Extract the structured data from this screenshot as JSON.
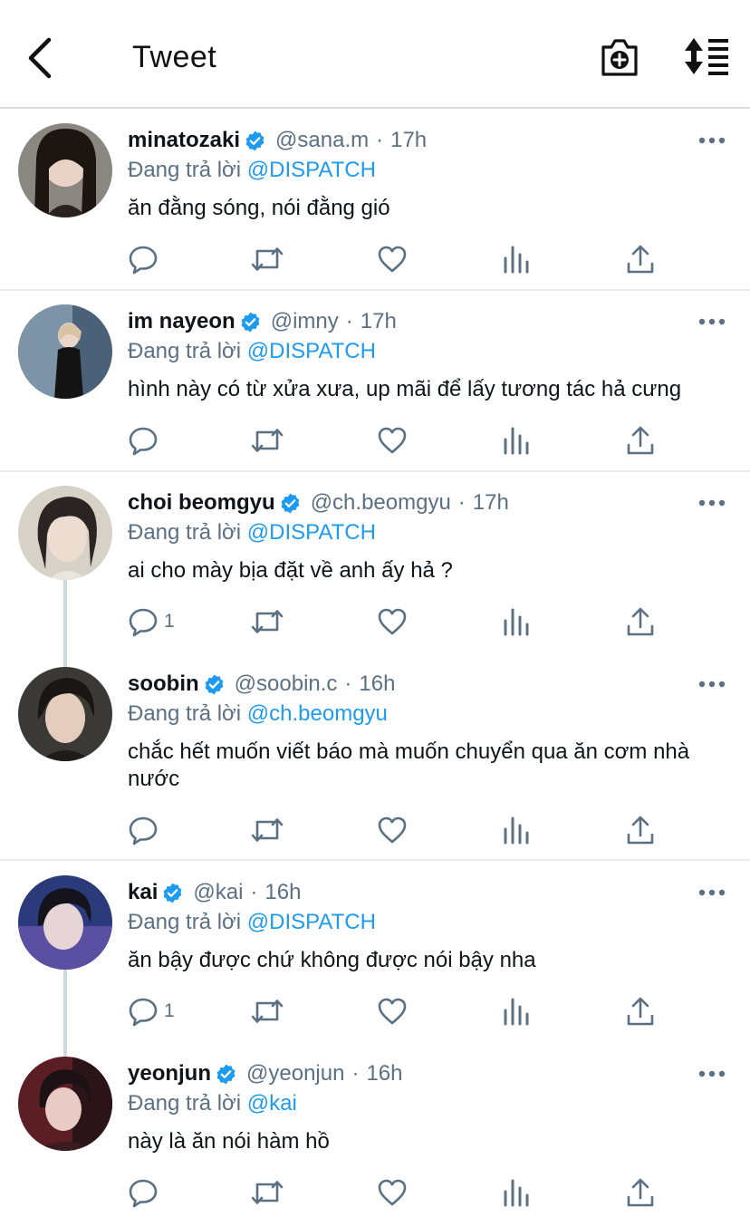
{
  "header": {
    "title": "Tweet"
  },
  "reply_prefix": "Đang trả lời",
  "tweets": [
    {
      "name": "minatozaki",
      "handle": "@sana.m",
      "time": "17h",
      "reply_to": "@DISPATCH",
      "text": "ăn đằng sóng, nói đằng gió",
      "reply_count": ""
    },
    {
      "name": "im nayeon",
      "handle": "@imny",
      "time": "17h",
      "reply_to": "@DISPATCH",
      "text": "hình này có từ xửa xưa, up mãi để lấy tương tác hả cưng",
      "reply_count": ""
    },
    {
      "name": "choi beomgyu",
      "handle": "@ch.beomgyu",
      "time": "17h",
      "reply_to": "@DISPATCH",
      "text": "ai cho mày bịa đặt về anh ấy hả ?",
      "reply_count": "1"
    },
    {
      "name": "soobin",
      "handle": "@soobin.c",
      "time": "16h",
      "reply_to": "@ch.beomgyu",
      "text": "chắc hết muốn viết báo mà muốn chuyển qua ăn cơm nhà nước",
      "reply_count": ""
    },
    {
      "name": "kai",
      "handle": "@kai",
      "time": "16h",
      "reply_to": "@DISPATCH",
      "text": "ăn bậy được chứ không được nói bậy nha",
      "reply_count": "1"
    },
    {
      "name": "yeonjun",
      "handle": "@yeonjun",
      "time": "16h",
      "reply_to": "@kai",
      "text": "này là ăn nói hàm hồ",
      "reply_count": ""
    }
  ],
  "icons": {
    "back": "chevron-left-icon",
    "camera": "camera-plus-icon",
    "sort": "sort-lines-icon",
    "verified": "verified-badge-icon",
    "more": "more-dots-icon",
    "reply": "reply-bubble-icon",
    "retweet": "retweet-icon",
    "like": "heart-icon",
    "stats": "analytics-bars-icon",
    "share": "share-upload-icon"
  },
  "colors": {
    "accent": "#1d9bf0",
    "muted": "#5b7083",
    "text": "#0f1419",
    "divider": "#e6ecf0"
  }
}
